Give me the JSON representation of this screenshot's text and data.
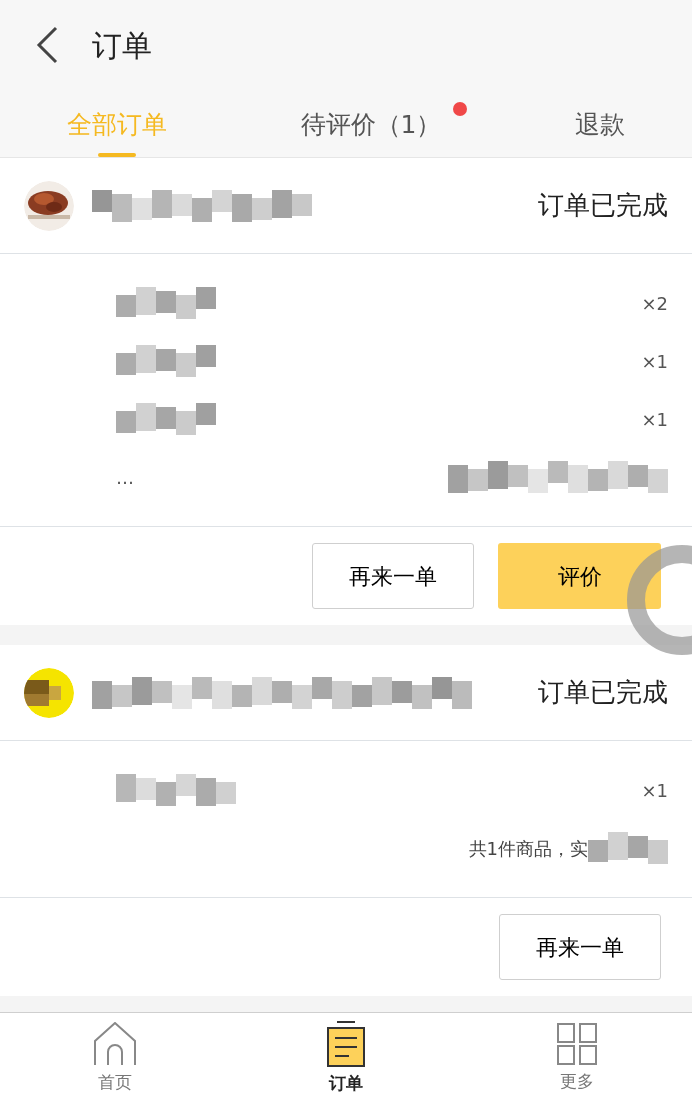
{
  "header": {
    "title": "订单"
  },
  "tabs": [
    {
      "label": "全部订单",
      "selected": true,
      "dot": false
    },
    {
      "label": "待评价（1）",
      "selected": false,
      "dot": true
    },
    {
      "label": "退款",
      "selected": false,
      "dot": false
    }
  ],
  "orders": [
    {
      "status": "订单已完成",
      "items": [
        {
          "quantity": "×2"
        },
        {
          "quantity": "×1"
        },
        {
          "quantity": "×1"
        }
      ],
      "more": "…",
      "buttons": [
        {
          "label": "再来一单",
          "kind": "outline"
        },
        {
          "label": "评价",
          "kind": "primary"
        }
      ]
    },
    {
      "status": "订单已完成",
      "items": [
        {
          "quantity": "×1"
        }
      ],
      "summary": "共1件商品，实",
      "buttons": [
        {
          "label": "再来一单",
          "kind": "outline"
        }
      ]
    }
  ],
  "bottom_nav": [
    {
      "label": "首页",
      "selected": false,
      "kind": "home"
    },
    {
      "label": "订单",
      "selected": true,
      "kind": "orders"
    },
    {
      "label": "更多",
      "selected": false,
      "kind": "more"
    }
  ]
}
